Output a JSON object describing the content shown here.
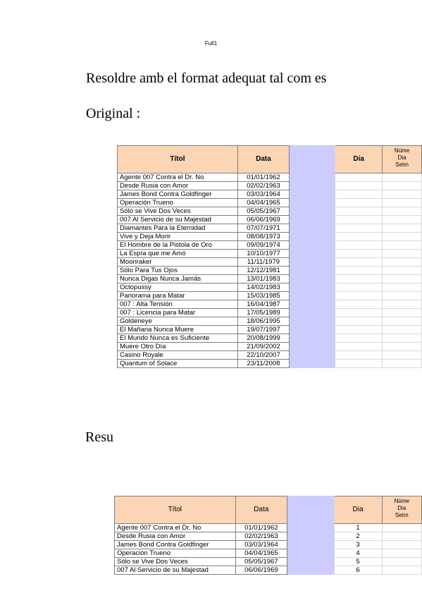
{
  "header": {
    "label": "Full1"
  },
  "instruction": "Resoldre amb el format adequat tal com es",
  "original_label": "Original :",
  "result_label": "Resu",
  "table": {
    "headers": {
      "titol": "Títol",
      "data": "Data",
      "blank": "",
      "dia": "Dia",
      "num_line1": "Núme",
      "num_line2": "Dia",
      "num_line3": "Setm"
    },
    "rows": [
      {
        "titol": "Agente 007 Contra el Dr. No",
        "data": "01/01/1962",
        "dia": "1"
      },
      {
        "titol": "Desde Rusia con Amor",
        "data": "02/02/1963",
        "dia": "2"
      },
      {
        "titol": "James Bond Contra Goldfinger",
        "data": "03/03/1964",
        "dia": "3"
      },
      {
        "titol": "Operación Trueno",
        "data": "04/04/1965",
        "dia": "4"
      },
      {
        "titol": "Sólo se Vive Dos Veces",
        "data": "05/05/1967",
        "dia": "5"
      },
      {
        "titol": "007 Al Servicio de su Majestad",
        "data": "06/06/1969",
        "dia": "6"
      },
      {
        "titol": "Diamantes Para la Eternidad",
        "data": "07/07/1971"
      },
      {
        "titol": "Vive y Deja Morir",
        "data": "08/08/1973"
      },
      {
        "titol": "El Hombre de la Pistola de Oro",
        "data": "09/09/1974"
      },
      {
        "titol": "La Espía que me Amó",
        "data": "10/10/1977"
      },
      {
        "titol": "Moonraker",
        "data": "11/11/1979"
      },
      {
        "titol": "Sólo Para Tus Ojos",
        "data": "12/12/1981"
      },
      {
        "titol": "Nunca Digas Nunca Jamás",
        "data": "13/01/1983"
      },
      {
        "titol": "Octopussy",
        "data": "14/02/1983"
      },
      {
        "titol": "Panorama para Matar",
        "data": "15/03/1985"
      },
      {
        "titol": "007 : Alta Tensión",
        "data": "16/04/1987"
      },
      {
        "titol": "007 : Licencia para Matar",
        "data": "17/05/1989"
      },
      {
        "titol": "Goldeneye",
        "data": "18/06/1995"
      },
      {
        "titol": "El Mañana Nunca Muere",
        "data": "19/07/1997"
      },
      {
        "titol": "El Mundo Nunca es Suficiente",
        "data": "20/08/1999"
      },
      {
        "titol": "Muere Otro Día",
        "data": "21/09/2002"
      },
      {
        "titol": "Casino Royale",
        "data": "22/10/2007"
      },
      {
        "titol": "Quantum of Solace",
        "data": "23/11/2008"
      }
    ]
  },
  "colors": {
    "header_fill": "#fcd5b4",
    "blank_column_fill": "#ccccff"
  }
}
